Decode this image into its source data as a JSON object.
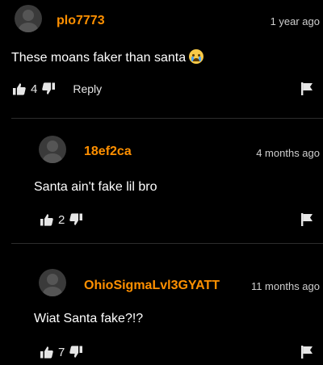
{
  "comments": [
    {
      "username": "plo7773",
      "time": "1 year ago",
      "text": "These moans faker than santa",
      "emoji": "crying-face-emoji",
      "likes": "4",
      "reply_label": "Reply"
    },
    {
      "username": "18ef2ca",
      "time": "4 months ago",
      "text": "Santa ain't fake lil bro",
      "likes": "2"
    },
    {
      "username": "OhioSigmaLvl3GYATT",
      "time": "11 months ago",
      "text": "Wiat Santa fake?!?",
      "likes": "7"
    }
  ],
  "icons": {
    "like": "thumbs-up-icon",
    "dislike": "thumbs-down-icon",
    "flag": "flag-icon",
    "avatar": "default-avatar"
  },
  "colors": {
    "background": "#000000",
    "username": "#ff9000",
    "text": "#ffffff",
    "muted": "#cfcfcf"
  }
}
